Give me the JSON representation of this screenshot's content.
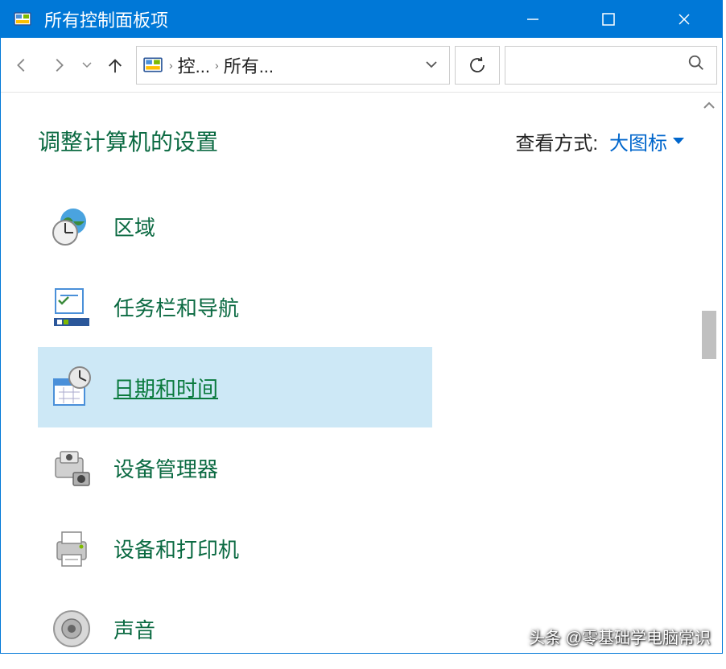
{
  "titlebar": {
    "title": "所有控制面板项"
  },
  "breadcrumb": {
    "item1": "控...",
    "item2": "所有..."
  },
  "header": {
    "title": "调整计算机的设置",
    "view_label": "查看方式:",
    "view_value": "大图标"
  },
  "items": [
    {
      "label": "区域"
    },
    {
      "label": "任务栏和导航"
    },
    {
      "label": "日期和时间"
    },
    {
      "label": "设备管理器"
    },
    {
      "label": "设备和打印机"
    },
    {
      "label": "声音"
    }
  ],
  "watermark": "头条 @零基础学电脑常识"
}
